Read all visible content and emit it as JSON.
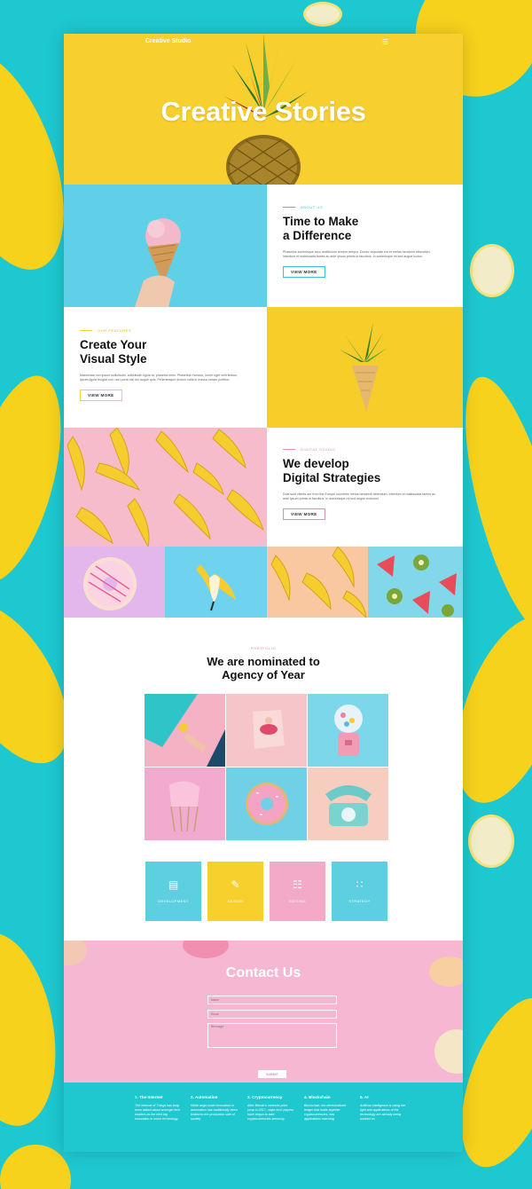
{
  "header": {
    "brand": "Creative Studio",
    "menu_icon": "hamburger-icon"
  },
  "hero": {
    "title": "Creative Stories"
  },
  "about": {
    "eyebrow": "ABOUT US",
    "title_line1": "Time to Make",
    "title_line2": "a Difference",
    "text": "Phasellus scelerisque arcu vestibulum tempor tempor. Donec vulputate est et metus hendrerit bibendum. Interdum et malesuada fames ac ante ipsum primis in faucibus. In scelerisque mi sed augue luctus.",
    "button": "VIEW MORE"
  },
  "features": {
    "eyebrow": "OUR FEATURES",
    "title_line1": "Create Your",
    "title_line2": "Visual Style",
    "text": "Maecenas non ipsum sollicitudin, sollicitudin ligula at, pharetra enim. Phasellus rhoncus, lorem eget velit finibus, ipsum ligula feugiat orci, non porta nisi dui augue quis. Pellentesque dictum nulla in massa ornare porttitor.",
    "button": "VIEW MORE"
  },
  "digital": {
    "eyebrow": "DIGITAL STUDIO",
    "title_line1": "We develop",
    "title_line2": "Digital Strategies",
    "text": "Duis sunt clients are from the Europe countries metus hendrerit bibendum. Interdum et malesuada fames ac ante ipsum primis in faucibus. In scelerisque mi sed augue euismod.",
    "button": "VIEW MORE"
  },
  "portfolio": {
    "eyebrow": "PORTFOLIO",
    "title_line1": "We are nominated to",
    "title_line2": "Agency of Year"
  },
  "services": [
    {
      "label": "DEVELOPMENT",
      "icon": "chart-icon",
      "color": "#5ccfe0"
    },
    {
      "label": "DESIGN",
      "icon": "design-icon",
      "color": "#f7d02e"
    },
    {
      "label": "EDITING",
      "icon": "editing-icon",
      "color": "#f3a9c8"
    },
    {
      "label": "STRATEGY",
      "icon": "strategy-icon",
      "color": "#5ccfe0"
    }
  ],
  "contact": {
    "title": "Contact Us",
    "name_placeholder": "Name",
    "email_placeholder": "Email",
    "message_placeholder": "Message",
    "submit": "SUBMIT"
  },
  "footer": [
    {
      "title": "1. The Internet",
      "text": "The Internet of Things has long been talked about amongst tech insiders as the next big innovation in home technology."
    },
    {
      "title": "2. Automation",
      "text": "While large-scale innovation in automation has traditionally been limited to the production side of society"
    },
    {
      "title": "3. Cryptocurrency",
      "text": "After Bitcoin's meteoric price jump in 2017, major tech players have begun to take cryptocurrencies seriously."
    },
    {
      "title": "4. Blockchain",
      "text": "Blockchain, the decentralized ledger that holds together cryptocurrencies, has applications reaching"
    },
    {
      "title": "5. AI",
      "text": "Artificial Intelligence is using the light and applications of the technology are already being worked on"
    }
  ],
  "colors": {
    "accent_yellow": "#f7cf2e",
    "accent_pink": "#f3a9c8",
    "accent_cyan": "#1fc7cf"
  }
}
